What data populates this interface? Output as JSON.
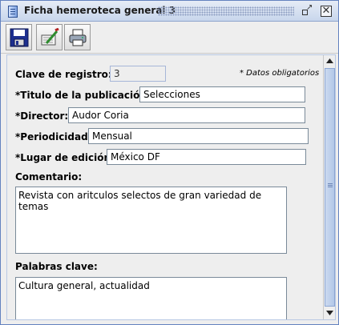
{
  "window": {
    "title": "Ficha hemeroteca general 3"
  },
  "toolbar": {
    "buttons": [
      {
        "icon": "save-icon",
        "tooltip": ""
      },
      {
        "icon": "clear-icon",
        "tooltip": ""
      },
      {
        "icon": "print-icon",
        "tooltip": ""
      }
    ]
  },
  "form": {
    "required_note": "* Datos obligatorios",
    "clave": {
      "label": "Clave de registro:",
      "value": "3"
    },
    "titulo": {
      "label": "*Titulo de la publicación:",
      "value": "Selecciones"
    },
    "director": {
      "label": "*Director:",
      "value": "Audor Coria"
    },
    "periodicidad": {
      "label": "*Periodicidad:",
      "value": "Mensual"
    },
    "lugar": {
      "label": "*Lugar de edición:",
      "value": "México DF"
    },
    "comentario": {
      "label": "Comentario:",
      "value": "Revista con aritculos selectos de gran variedad de temas"
    },
    "palabras": {
      "label": "Palabras clave:",
      "value": "Cultura general, actualidad"
    }
  },
  "colors": {
    "title_bar": "#c8d6ec",
    "window_border": "#6382bf",
    "scroll_thumb": "#b3c8e8"
  }
}
